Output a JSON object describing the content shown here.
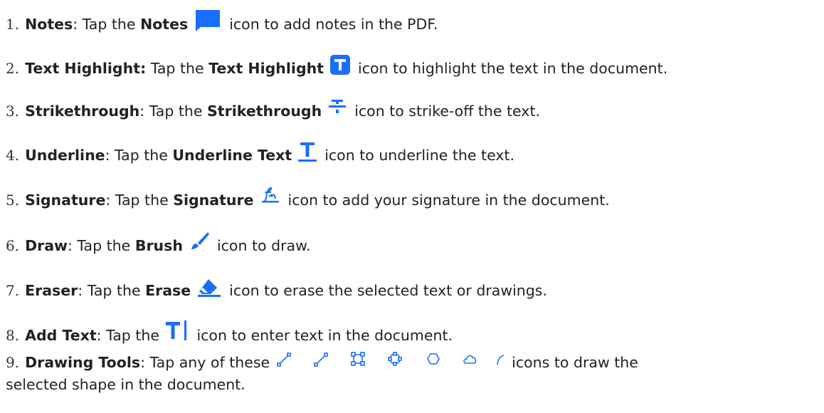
{
  "colors": {
    "accent": "#1a6efc",
    "text": "#222222"
  },
  "items": [
    {
      "num": "1.",
      "title": "Notes",
      "sep": ": Tap the ",
      "tool": "Notes",
      "icon": "notes-icon",
      "rest": "icon to add notes in the PDF."
    },
    {
      "num": "2.",
      "title": "Text Highlight:",
      "sep": " Tap the ",
      "tool": "Text Highlight",
      "icon": "text-highlight-icon",
      "rest": "icon to highlight the text in the document."
    },
    {
      "num": "3.",
      "title": "Strikethrough",
      "sep": ": Tap the ",
      "tool": "Strikethrough",
      "icon": "strikethrough-icon",
      "rest": "icon to strike-off the text."
    },
    {
      "num": "4.",
      "title": "Underline",
      "sep": ": Tap the ",
      "tool": "Underline Text",
      "icon": "underline-icon",
      "rest": "icon to underline the text."
    },
    {
      "num": "5.",
      "title": "Signature",
      "sep": ": Tap the ",
      "tool": "Signature",
      "icon": "signature-icon",
      "rest": "icon to add your signature in the document."
    },
    {
      "num": "6.",
      "title": "Draw",
      "sep": ": Tap the ",
      "tool": "Brush",
      "icon": "brush-icon",
      "rest": "icon to draw."
    },
    {
      "num": "7.",
      "title": "Eraser",
      "sep": ": Tap the ",
      "tool": "Erase",
      "icon": "eraser-icon",
      "rest": "icon to erase the selected text or drawings."
    },
    {
      "num": "8.",
      "title": "Add Text",
      "sep": ": Tap the ",
      "tool": "",
      "icon": "add-text-icon",
      "rest": "icon to enter text in the document."
    },
    {
      "num": "9.",
      "title": "Drawing Tools",
      "sep": ": Tap any of these",
      "tool": "",
      "icon": "shape-tools-icons",
      "rest": "icons to draw the",
      "rest2": "selected shape in the document."
    }
  ],
  "shape_icons": [
    "line-icon",
    "arrow-icon",
    "rectangle-icon",
    "polygon-handles-icon",
    "hexagon-icon",
    "cloud-icon",
    "curve-icon"
  ]
}
